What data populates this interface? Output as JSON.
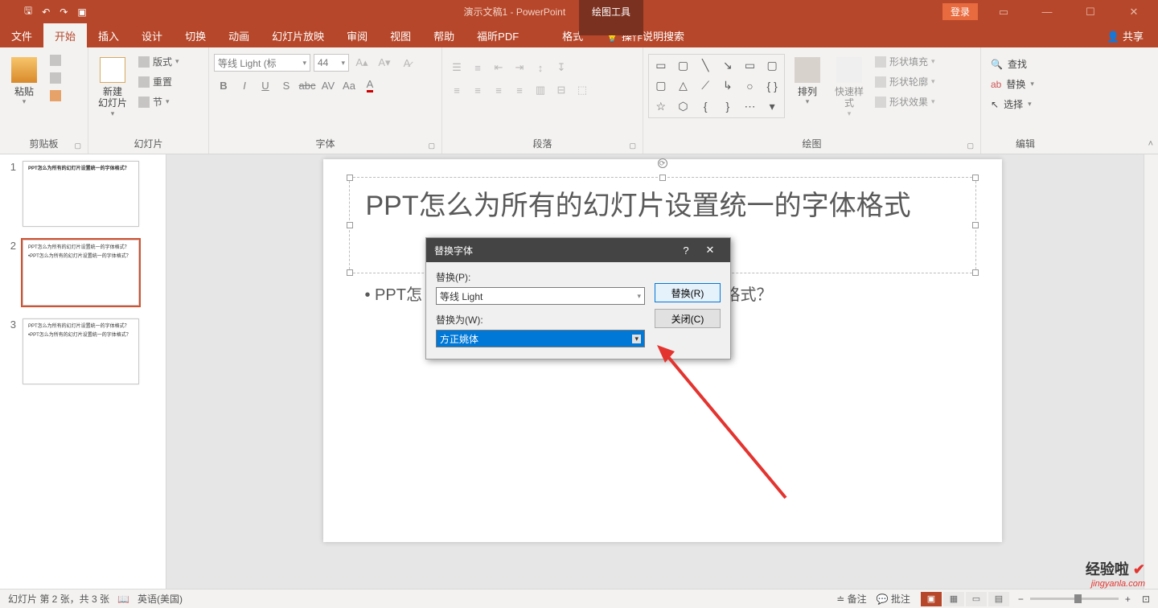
{
  "titlebar": {
    "doc_title": "演示文稿1 - PowerPoint",
    "tool_tab": "绘图工具",
    "login": "登录",
    "share": "共享"
  },
  "menu": {
    "tabs": [
      "文件",
      "开始",
      "插入",
      "设计",
      "切换",
      "动画",
      "幻灯片放映",
      "审阅",
      "视图",
      "帮助",
      "福昕PDF",
      "格式"
    ],
    "tell_me": "操作说明搜索"
  },
  "ribbon": {
    "clipboard": {
      "paste": "粘贴",
      "label": "剪贴板"
    },
    "slides": {
      "new_slide": "新建\n幻灯片",
      "layout": "版式",
      "reset": "重置",
      "section": "节",
      "label": "幻灯片"
    },
    "font": {
      "name": "等线 Light (标",
      "size": "44",
      "label": "字体"
    },
    "para": {
      "label": "段落"
    },
    "draw": {
      "arrange": "排列",
      "quick": "快速样式",
      "fill": "形状填充",
      "outline": "形状轮廓",
      "effects": "形状效果",
      "label": "绘图"
    },
    "edit": {
      "find": "查找",
      "replace": "替换",
      "select": "选择",
      "label": "编辑"
    }
  },
  "slide": {
    "title": "PPT怎么为所有的幻灯片设置统一的字体格式",
    "bullet": "• PPT怎",
    "bullet_tail": "格式？"
  },
  "thumbs": {
    "t1": "PPT怎么为所有的幻灯片设置统一的字体格式？",
    "t2a": "PPT怎么为所有的幻灯片设置统一的字体格式？",
    "t2b": "•PPT怎么为所有的幻灯片设置统一的字体格式？",
    "t3a": "PPT怎么为所有的幻灯片设置统一的字体格式？",
    "t3b": "•PPT怎么为所有的幻灯片设置统一的字体格式？"
  },
  "dialog": {
    "title": "替换字体",
    "replace_label": "替换(P):",
    "replace_value": "等线 Light",
    "with_label": "替换为(W):",
    "with_value": "方正姚体",
    "btn_replace": "替换(R)",
    "btn_close": "关闭(C)"
  },
  "status": {
    "slide_info": "幻灯片 第 2 张，共 3 张",
    "lang": "英语(美国)",
    "notes": "备注",
    "comments": "批注"
  },
  "watermark": {
    "text": "经验啦",
    "url": "jingyanla.com"
  }
}
